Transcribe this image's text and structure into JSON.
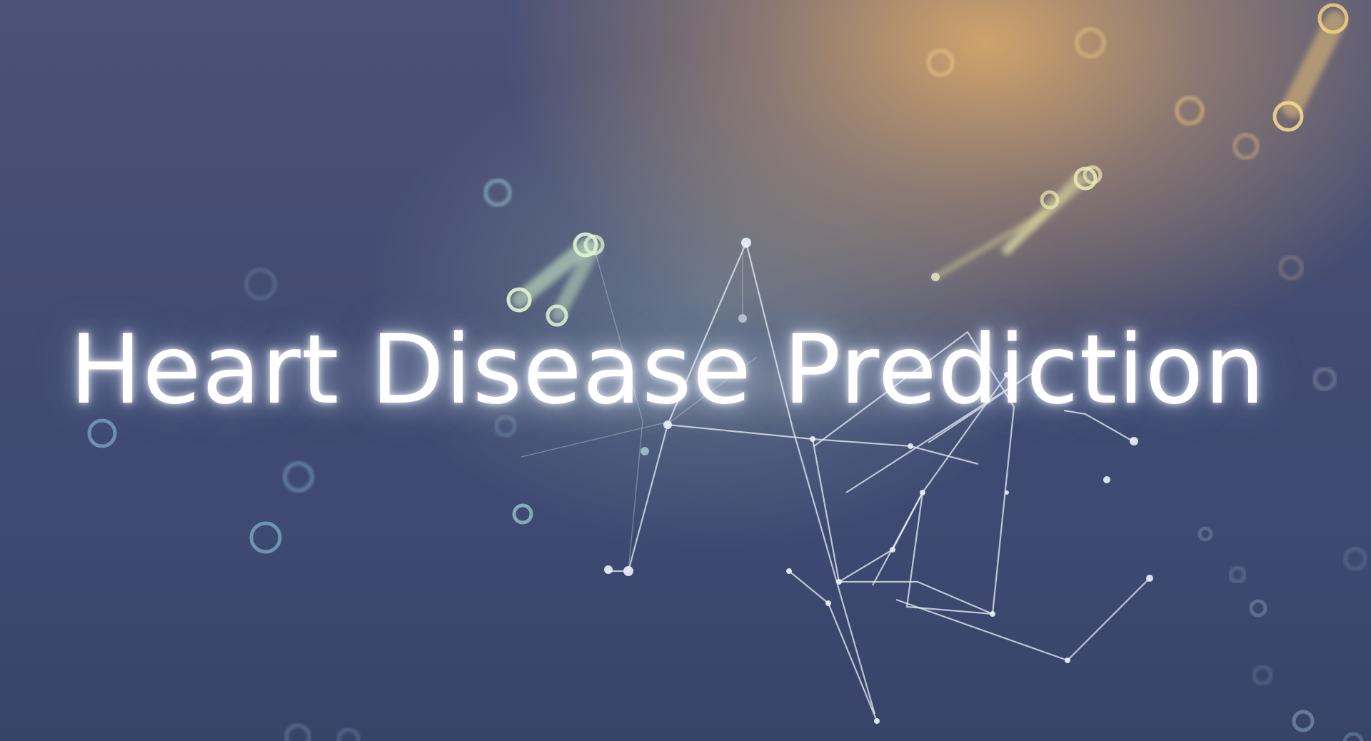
{
  "title": "Heart Disease Prediction",
  "colors": {
    "background_base": "#3e4a72",
    "warm_glow": "#d6a66a",
    "title_text": "#ffffff",
    "particle_teal": "#9fd6e8",
    "particle_green": "#c8e6b0",
    "line_white": "#e8eef6"
  },
  "decor": {
    "type": "plexus-particle-network",
    "elements": [
      "circle-particle",
      "connector-line",
      "node-dot"
    ]
  }
}
